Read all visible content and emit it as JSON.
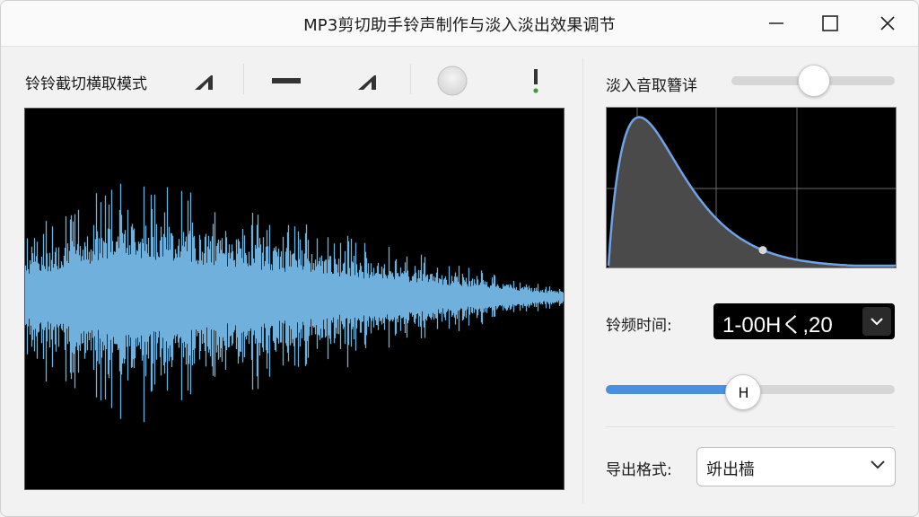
{
  "window": {
    "title": "MP3剪切助手铃声制作与淡入淡出效果调节"
  },
  "toolbar": {
    "mode_label": "铃铃截切横取模式",
    "tools": [
      {
        "name": "fade-in-tool-icon"
      },
      {
        "name": "flat-line-tool-icon"
      },
      {
        "name": "fade-out-tool-icon"
      },
      {
        "name": "record-circle-icon"
      },
      {
        "name": "alert-exclamation-icon",
        "accent": "#3aa13a"
      }
    ]
  },
  "waveform": {
    "background": "#000000",
    "color": "#6fb0dc"
  },
  "fade_in": {
    "label": "淡入音取簪详",
    "slider_value": 0.5
  },
  "fade_curve": {
    "line_color": "#6ea3e6",
    "fill_color": "#4a4a4a"
  },
  "ringtone_freq": {
    "label": "铃频时间:",
    "value": "1-00Hく,20"
  },
  "position_slider": {
    "knob_label": "H",
    "value": 0.47,
    "fill_color": "#4a90e2"
  },
  "export": {
    "label": "导出格式:",
    "value": "竔出樯"
  }
}
